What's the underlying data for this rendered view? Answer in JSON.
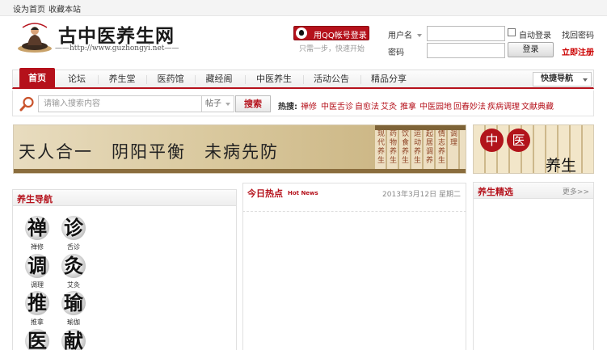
{
  "topbar": {
    "set_home": "设为首页",
    "bookmark": "收藏本站"
  },
  "logo": {
    "title": "古中医养生网",
    "url": "——http://www.guzhongyi.net——"
  },
  "qq": {
    "login_label": "用QQ帐号登录",
    "tip": "只需一步，快速开始"
  },
  "login": {
    "username_label": "用户名",
    "password_label": "密码",
    "auto_login": "自动登录",
    "find_password": "找回密码",
    "submit": "登录",
    "register": "立即注册"
  },
  "nav": {
    "items": [
      "首页",
      "论坛",
      "养生堂",
      "医药馆",
      "藏经阁",
      "中医养生",
      "活动公告",
      "精品分享"
    ],
    "active": "首页",
    "quick_nav": "快捷导航"
  },
  "search": {
    "placeholder": "请输入搜索内容",
    "type": "帖子",
    "button": "搜索",
    "hot_label": "热搜:",
    "hot_words": [
      "禅修",
      "中医舌诊",
      "自愈法",
      "艾灸",
      "推拿",
      "中医园地",
      "回春妙法",
      "疾病调理",
      "文献典藏"
    ]
  },
  "banner_main": {
    "slogan": "天人合一　阴阳平衡　未病先防",
    "scroll_text": [
      "现代养生",
      "药物养生",
      "饮食养生",
      "运动养生",
      "起居调养",
      "情志养生",
      "调理"
    ]
  },
  "banner_side": {
    "seal_1": "中",
    "seal_2": "医",
    "title": "养生"
  },
  "panels": {
    "nav_title": "养生导航",
    "news_title": "今日热点",
    "news_badge": "Hot News",
    "news_date": "2013年3月12日 星期二",
    "picks_title": "养生精选",
    "picks_more": "更多>>"
  },
  "nav_icons": [
    {
      "glyph": "禅",
      "label": "禅修"
    },
    {
      "glyph": "诊",
      "label": "舌诊"
    },
    {
      "glyph": "调",
      "label": "调理"
    },
    {
      "glyph": "灸",
      "label": "艾灸"
    },
    {
      "glyph": "推",
      "label": "推拿"
    },
    {
      "glyph": "瑜",
      "label": "瑜伽"
    },
    {
      "glyph": "医",
      "label": ""
    },
    {
      "glyph": "献",
      "label": ""
    }
  ],
  "colors": {
    "brand_red": "#b5111b",
    "border": "#e0e0e0"
  }
}
